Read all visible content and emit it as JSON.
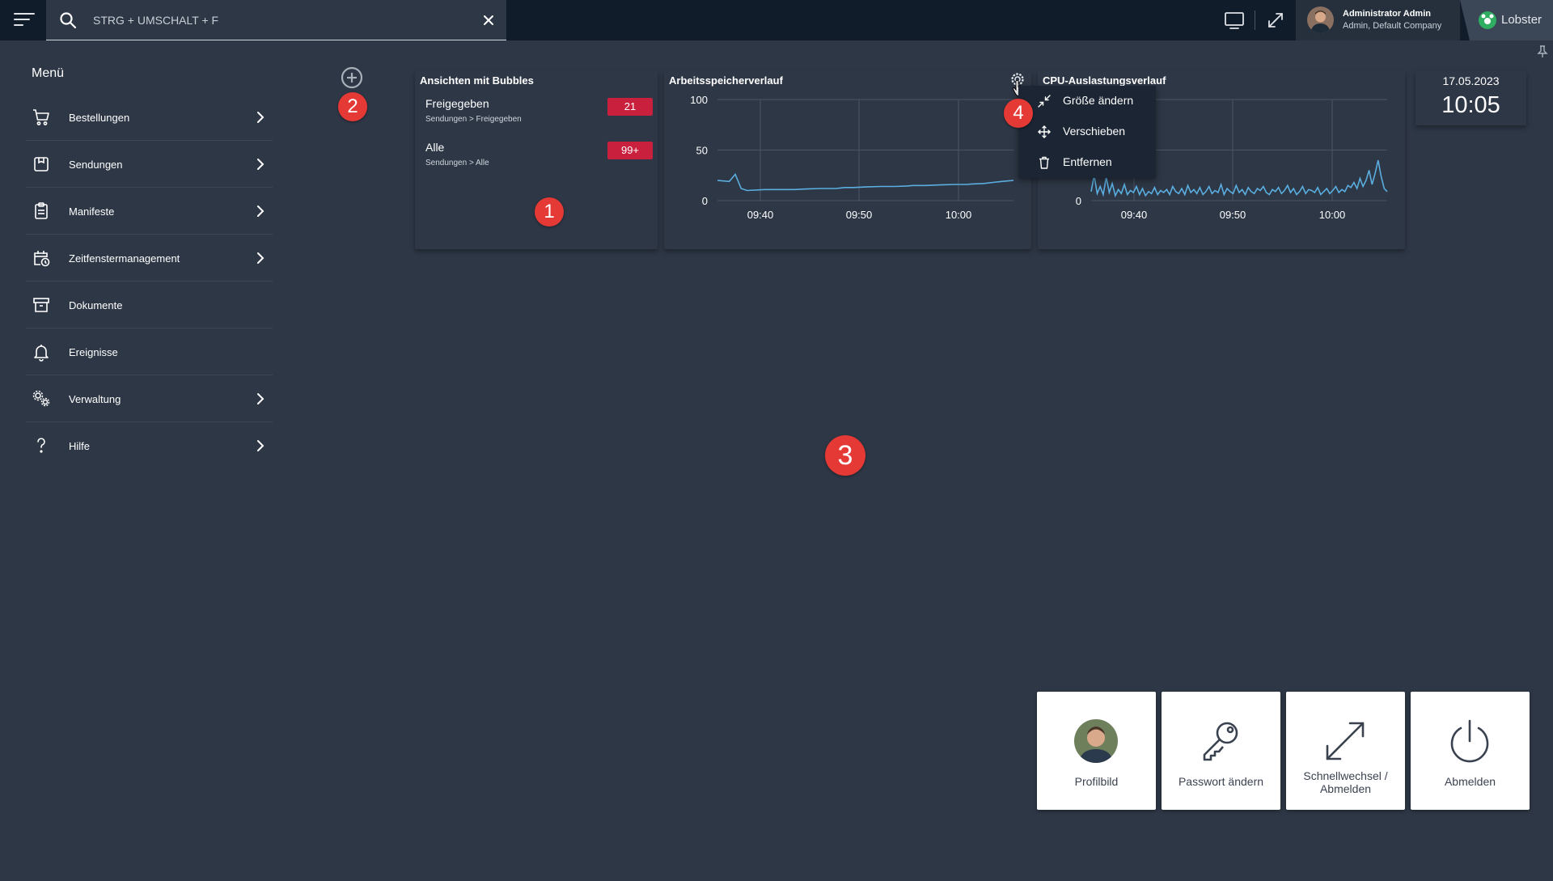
{
  "topbar": {
    "search_placeholder": "STRG + UMSCHALT + F",
    "user_name": "Administrator Admin",
    "user_company": "Admin, Default Company",
    "brand_name": "Lobster"
  },
  "sidebar": {
    "title": "Menü",
    "items": [
      {
        "label": "Bestellungen",
        "icon": "cart-icon",
        "has_submenu": true
      },
      {
        "label": "Sendungen",
        "icon": "package-icon",
        "has_submenu": true
      },
      {
        "label": "Manifeste",
        "icon": "clipboard-icon",
        "has_submenu": true
      },
      {
        "label": "Zeitfenstermanagement",
        "icon": "calendar-clock-icon",
        "has_submenu": true
      },
      {
        "label": "Dokumente",
        "icon": "archive-icon",
        "has_submenu": false
      },
      {
        "label": "Ereignisse",
        "icon": "bell-icon",
        "has_submenu": false
      },
      {
        "label": "Verwaltung",
        "icon": "gears-icon",
        "has_submenu": true
      },
      {
        "label": "Hilfe",
        "icon": "question-icon",
        "has_submenu": true
      }
    ]
  },
  "markers": {
    "m1": "1",
    "m2": "2",
    "m3": "3",
    "m4": "4"
  },
  "bubbles_widget": {
    "title": "Ansichten mit Bubbles",
    "rows": [
      {
        "label": "Freigegeben",
        "path": "Sendungen > Freigegeben",
        "count": "21"
      },
      {
        "label": "Alle",
        "path": "Sendungen > Alle",
        "count": "99+"
      }
    ]
  },
  "memory_widget": {
    "title": "Arbeitsspeicherverlauf"
  },
  "cpu_widget": {
    "title": "CPU-Auslastungsverlauf"
  },
  "context_menu": {
    "items": [
      {
        "label": "Größe ändern",
        "icon": "resize-icon"
      },
      {
        "label": "Verschieben",
        "icon": "move-icon"
      },
      {
        "label": "Entfernen",
        "icon": "trash-icon"
      }
    ]
  },
  "clock": {
    "date": "17.05.2023",
    "time": "10:05"
  },
  "tiles": [
    {
      "label": "Profilbild",
      "icon": "profile-photo-icon"
    },
    {
      "label": "Passwort ändern",
      "icon": "key-icon"
    },
    {
      "label_line1": "Schnellwechsel /",
      "label_line2": "Abmelden",
      "icon": "switch-icon"
    },
    {
      "label": "Abmelden",
      "icon": "power-icon"
    }
  ],
  "colors": {
    "background": "#2e3746",
    "topbar": "#111c2b",
    "badge": "#c8203d",
    "line": "#5aaee0",
    "marker": "#e53935"
  },
  "chart_data": [
    {
      "type": "line",
      "title": "Arbeitsspeicherverlauf",
      "x_ticks": [
        "09:40",
        "09:50",
        "10:00"
      ],
      "y_ticks": [
        "0",
        "50",
        "100"
      ],
      "ylim": [
        0,
        100
      ],
      "x": [
        0,
        4,
        6,
        8,
        10,
        16,
        23,
        26,
        30,
        35,
        40,
        43,
        46,
        50,
        55,
        60,
        64,
        66,
        70,
        75,
        80,
        84,
        86,
        90,
        93,
        96,
        100
      ],
      "values": [
        20,
        19,
        26,
        12,
        10,
        11,
        11,
        11,
        11.5,
        12,
        12,
        13,
        13,
        13.5,
        14,
        14,
        14.5,
        15,
        15,
        15.5,
        16,
        16,
        16.5,
        17,
        18,
        19,
        20
      ],
      "grid": true
    },
    {
      "type": "line",
      "title": "CPU-Auslastungsverlauf",
      "x_ticks": [
        "09:40",
        "09:50",
        "10:00"
      ],
      "y_ticks": [
        "0"
      ],
      "ylim": [
        0,
        100
      ],
      "values": [
        9,
        25,
        7,
        14,
        6,
        23,
        8,
        17,
        5,
        11,
        7,
        16,
        6,
        10,
        8,
        14,
        6,
        12,
        5,
        9,
        7,
        13,
        6,
        10,
        8,
        11,
        6,
        14,
        9,
        7,
        12,
        6,
        15,
        8,
        11,
        7,
        13,
        6,
        9,
        14,
        7,
        10,
        8,
        16,
        6,
        12,
        9,
        7,
        15,
        8,
        11,
        6,
        13,
        9,
        7,
        12,
        10,
        14,
        8,
        6,
        11,
        9,
        13,
        7,
        10,
        15,
        8,
        12,
        6,
        9,
        14,
        7,
        11,
        10,
        8,
        13,
        6,
        9,
        12,
        7,
        10,
        14,
        8,
        11,
        9,
        15,
        13,
        18,
        12,
        22,
        14,
        20,
        30,
        16,
        27,
        40,
        24,
        12,
        9
      ],
      "grid": true
    }
  ]
}
